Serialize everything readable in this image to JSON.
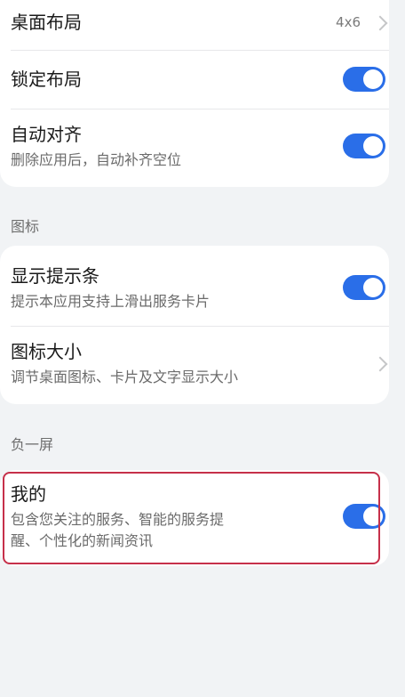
{
  "desktop_layout": {
    "title": "桌面布局",
    "value": "4x6"
  },
  "lock_layout": {
    "title": "锁定布局",
    "toggle_on": true
  },
  "auto_align": {
    "title": "自动对齐",
    "subtitle": "删除应用后，自动补齐空位",
    "toggle_on": true
  },
  "section_icons": {
    "label": "图标"
  },
  "show_hint_bar": {
    "title": "显示提示条",
    "subtitle": "提示本应用支持上滑出服务卡片",
    "toggle_on": true
  },
  "icon_size": {
    "title": "图标大小",
    "subtitle": "调节桌面图标、卡片及文字显示大小"
  },
  "section_minus_one": {
    "label": "负一屏"
  },
  "my_feed": {
    "title": "我的",
    "subtitle_line1": "包含您关注的服务、智能的服务提",
    "subtitle_line2": "醒、个性化的新闻资讯",
    "toggle_on": true
  },
  "colors": {
    "toggle_on": "#2a6ee8",
    "highlight_border": "#c6304a",
    "background": "#f1f3f5"
  }
}
